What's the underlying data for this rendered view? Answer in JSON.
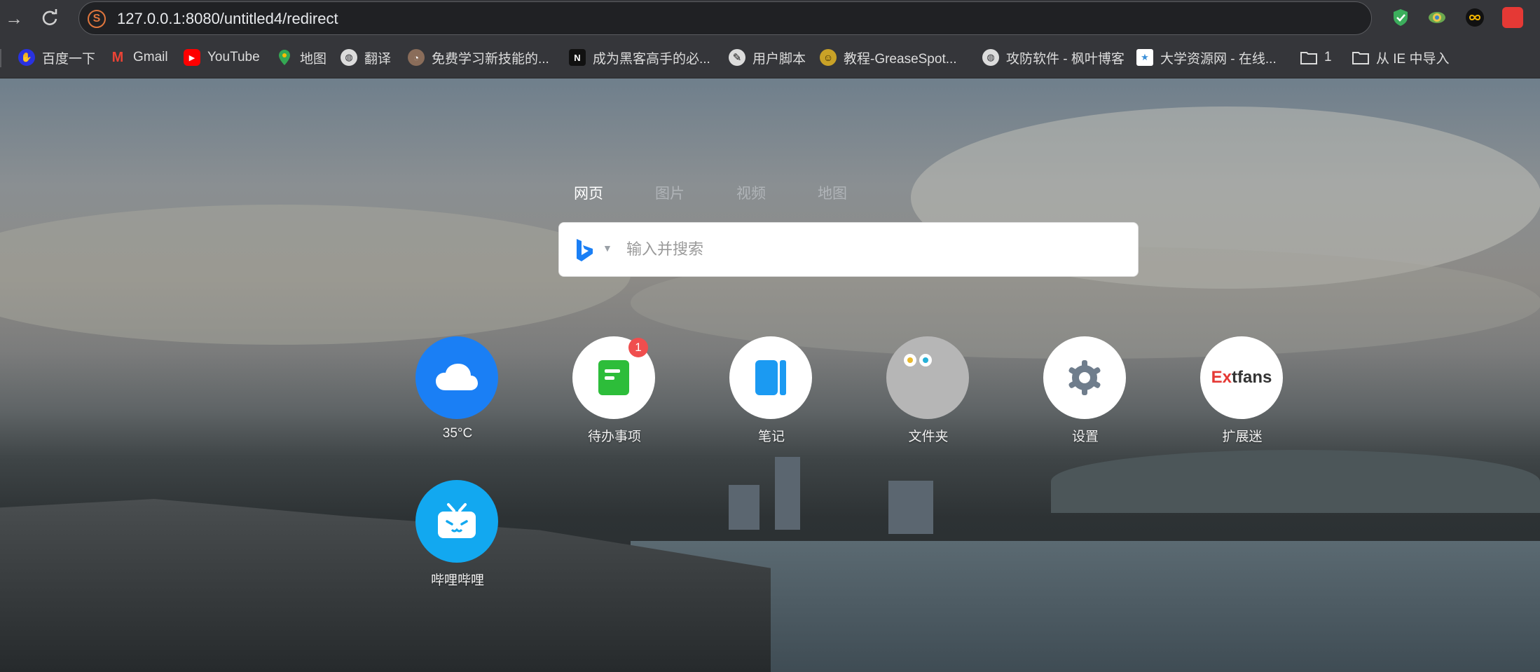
{
  "browser": {
    "url": "127.0.0.1:8080/untitled4/redirect",
    "extensions": [
      "shield-check-extension-icon",
      "ie-tab-extension-icon",
      "infinity-extension-icon",
      "red-extension-icon"
    ]
  },
  "bookmarks": [
    {
      "label": "百度一下",
      "icon": "baidu-icon",
      "color": "#2932e1"
    },
    {
      "label": "Gmail",
      "icon": "gmail-icon",
      "color": "#ea4335"
    },
    {
      "label": "YouTube",
      "icon": "youtube-icon",
      "color": "#ff0000"
    },
    {
      "label": "地图",
      "icon": "maps-icon",
      "color": "#34a853"
    },
    {
      "label": "翻译",
      "icon": "globe-icon",
      "color": "#5f6368"
    },
    {
      "label": "免费学习新技能的...",
      "icon": "avatar-icon",
      "color": "#8a6d5a"
    },
    {
      "label": "成为黑客高手的必...",
      "icon": "notion-icon",
      "color": "#111111"
    },
    {
      "label": "用户脚本",
      "icon": "script-icon",
      "color": "#222222"
    },
    {
      "label": "教程-GreaseSpot...",
      "icon": "greasemonkey-icon",
      "color": "#c9a227"
    },
    {
      "label": "攻防软件 - 枫叶博客",
      "icon": "globe-icon",
      "color": "#5f6368"
    },
    {
      "label": "大学资源网 - 在线...",
      "icon": "university-icon",
      "color": "#3a8fd8"
    },
    {
      "label": "1",
      "icon": "folder-icon",
      "color": "#dcdcdc"
    },
    {
      "label": "从 IE 中导入",
      "icon": "folder-icon",
      "color": "#dcdcdc"
    }
  ],
  "search": {
    "tabs": [
      {
        "label": "网页",
        "active": true
      },
      {
        "label": "图片",
        "active": false
      },
      {
        "label": "视频",
        "active": false
      },
      {
        "label": "地图",
        "active": false
      }
    ],
    "engine_icon": "bing-icon",
    "placeholder": "输入并搜索"
  },
  "apps": [
    {
      "label": "35°C",
      "icon": "cloud-icon",
      "bg": "#1a7ff5"
    },
    {
      "label": "待办事项",
      "icon": "todo-icon",
      "bg": "#ffffff",
      "badge": "1"
    },
    {
      "label": "笔记",
      "icon": "notebook-icon",
      "bg": "#ffffff"
    },
    {
      "label": "文件夹",
      "icon": "folder-eyes-icon",
      "bg": "#b6b6b6"
    },
    {
      "label": "设置",
      "icon": "gear-icon",
      "bg": "#ffffff"
    },
    {
      "label": "扩展迷",
      "icon": "extfans-logo-icon",
      "bg": "#ffffff",
      "logo_text_1": "Ex",
      "logo_text_2": "tfans"
    },
    {
      "label": "哔哩哔哩",
      "icon": "bilibili-icon",
      "bg": "#12a8f0"
    }
  ]
}
